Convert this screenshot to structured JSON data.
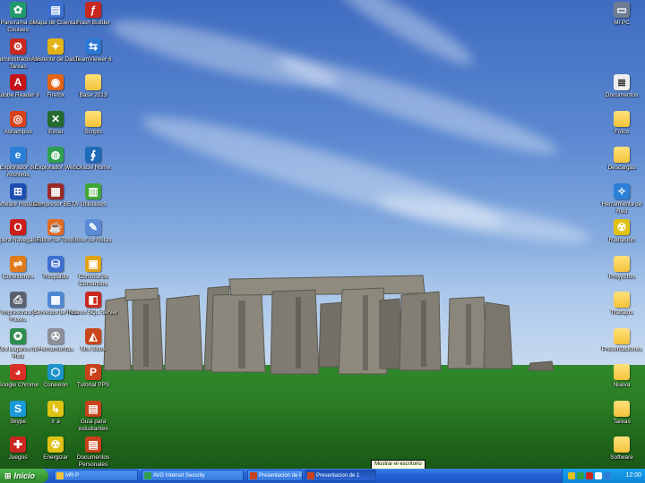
{
  "desktop": {
    "icons_left": [
      {
        "label": "Panorama de Coulees",
        "icon": "leaf-app-icon",
        "color": "#1f9a6b",
        "g": "✿"
      },
      {
        "label": "Mapa de Cuentas",
        "icon": "document-icon",
        "color": "#3b6fd0",
        "g": "▤"
      },
      {
        "label": "Flash Builder",
        "icon": "flash-icon",
        "color": "#c8281f",
        "g": "ƒ"
      },
      {
        "label": "Administrador de Tareas",
        "icon": "admin-tool-icon",
        "color": "#c8281f",
        "g": "⚙"
      },
      {
        "label": "Asistente de Datos",
        "icon": "bulb-icon",
        "color": "#e2b318",
        "g": "✦"
      },
      {
        "label": "TeamViewer 6",
        "icon": "teamviewer-icon",
        "color": "#2c78d4",
        "g": "⇆"
      },
      {
        "label": "Adobe Reader 9",
        "icon": "pdf-icon",
        "color": "#c3141a",
        "g": "A"
      },
      {
        "label": "Firefox",
        "icon": "firefox-icon",
        "color": "#e36414",
        "g": "◉"
      },
      {
        "label": "Base 2013",
        "icon": "folder-icon",
        "color": "#f3c33b",
        "g": ""
      },
      {
        "label": "Ashampoo",
        "icon": "ashampoo-icon",
        "color": "#d8421d",
        "g": "◎"
      },
      {
        "label": "Excel",
        "icon": "excel-icon",
        "color": "#256b2f",
        "g": "✕"
      },
      {
        "label": "Scripts",
        "icon": "folder-icon",
        "color": "#f3c33b",
        "g": ""
      },
      {
        "label": "Explorador de Archivos",
        "icon": "explorer-icon",
        "color": "#2b7fd7",
        "g": "e"
      },
      {
        "label": "Explorador Web",
        "icon": "globe-icon",
        "color": "#2e9f50",
        "g": "◍"
      },
      {
        "label": "Oracle Home",
        "icon": "oracle-icon",
        "color": "#1d6ab8",
        "g": "∮"
      },
      {
        "label": "Software Instalado",
        "icon": "windows-icon",
        "color": "#1d4fb3",
        "g": "⊞"
      },
      {
        "label": "Compresor BETA",
        "icon": "winrar-icon",
        "color": "#9d2a2a",
        "g": "▦"
      },
      {
        "label": "Utilidades",
        "icon": "utilities-icon",
        "color": "#3fa535",
        "g": "▥"
      },
      {
        "label": "Opera Navegador",
        "icon": "opera-icon",
        "color": "#cc1b1b",
        "g": "O"
      },
      {
        "label": "Editor de Texto",
        "icon": "java-icon",
        "color": "#e36a1f",
        "g": "☕"
      },
      {
        "label": "Bloc de Notas",
        "icon": "notepad-icon",
        "color": "#5c8bd6",
        "g": "✎"
      },
      {
        "label": "Conexiones",
        "icon": "network-icon",
        "color": "#e07a1a",
        "g": "⇌"
      },
      {
        "label": "Respaldo",
        "icon": "backup-icon",
        "color": "#3b6fd0",
        "g": "⛁"
      },
      {
        "label": "Consola de Comandos",
        "icon": "console-icon",
        "color": "#e0a215",
        "g": "▣"
      },
      {
        "label": "Impresoras y Faxes",
        "icon": "printer-icon",
        "color": "#58616f",
        "g": "⎙"
      },
      {
        "label": "Servicios de Red",
        "icon": "network-drive-icon",
        "color": "#4f88d6",
        "g": "▩"
      },
      {
        "label": "Nuevo SQL Server",
        "icon": "sql-icon",
        "color": "#c8281f",
        "g": "◧"
      },
      {
        "label": "Mis Lugares de Red",
        "icon": "network-places-icon",
        "color": "#2f8d4e",
        "g": "✪"
      },
      {
        "label": "Herramientas",
        "icon": "tools-icon",
        "color": "#8a8f99",
        "g": "✇"
      },
      {
        "label": "Mis Sitios",
        "icon": "office-icon",
        "color": "#c9461d",
        "g": "◭"
      },
      {
        "label": "Google Chrome",
        "icon": "chrome-icon",
        "color": "#d93025",
        "g": "◕"
      },
      {
        "label": "Conexion",
        "icon": "connection-icon",
        "color": "#1b92c9",
        "g": "⬡"
      },
      {
        "label": "Tutorial PPS",
        "icon": "powerpoint-icon",
        "color": "#c8421b",
        "g": "P"
      },
      {
        "label": "Skype",
        "icon": "skype-icon",
        "color": "#1b9ad9",
        "g": "S"
      },
      {
        "label": "Ir a",
        "icon": "shortcut-icon",
        "color": "#e0c215",
        "g": "↳"
      },
      {
        "label": "Guia para estudiantes",
        "icon": "guide-icon",
        "color": "#c8421b",
        "g": "▤"
      },
      {
        "label": "Juegos",
        "icon": "games-icon",
        "color": "#c8281f",
        "g": "✚"
      },
      {
        "label": "Energizar",
        "icon": "radiation-icon",
        "color": "#e0c215",
        "g": "☢"
      },
      {
        "label": "Documentos Personales",
        "icon": "docs-icon",
        "color": "#c8421b",
        "g": "▤"
      }
    ],
    "icons_right": [
      {
        "label": "Mi PC",
        "icon": "computer-icon",
        "color": "#6f7d92",
        "g": "▭",
        "folder": false
      },
      {
        "label": "Documentos",
        "icon": "text-file-icon",
        "color": "#eeeeee",
        "g": "≣",
        "folder": false
      },
      {
        "label": "Fotos",
        "icon": "folder-icon",
        "color": "#f3c33b",
        "g": "",
        "folder": true
      },
      {
        "label": "Descargas",
        "icon": "folder-icon",
        "color": "#f3c33b",
        "g": "",
        "folder": true
      },
      {
        "label": "Herramienta de Red",
        "icon": "safari-icon",
        "color": "#2b7fd7",
        "g": "✧",
        "folder": false
      },
      {
        "label": "Radiacion",
        "icon": "radiation-black-icon",
        "color": "#e0c215",
        "g": "☢",
        "folder": false
      },
      {
        "label": "Proyectos",
        "icon": "folder-icon",
        "color": "#f3c33b",
        "g": "",
        "folder": true
      },
      {
        "label": "Trabajos",
        "icon": "folder-icon",
        "color": "#f3c33b",
        "g": "",
        "folder": true
      },
      {
        "label": "Presentaciones",
        "icon": "folder-icon",
        "color": "#f3c33b",
        "g": "",
        "folder": true
      },
      {
        "label": "Nueva",
        "icon": "folder-icon",
        "color": "#f3c33b",
        "g": "",
        "folder": true
      },
      {
        "label": "Tareas",
        "icon": "folder-icon",
        "color": "#f3c33b",
        "g": "",
        "folder": true
      },
      {
        "label": "Software",
        "icon": "folder-icon",
        "color": "#f3c33b",
        "g": "",
        "folder": true
      }
    ],
    "tooltip": "Mostrar el escritorio"
  },
  "taskbar": {
    "start_label": "Inicio",
    "tasks": [
      {
        "label": "MR P",
        "color": "#f3c33b"
      },
      {
        "label": "AVG Internet Security",
        "color": "#2e9f50"
      },
      {
        "label": "Presentacion de PowerPoint",
        "color": "#c8421b"
      },
      {
        "label": "Presentacion de 1",
        "color": "#c8421b"
      }
    ],
    "active_task_index": 3,
    "clock": "12:00",
    "tray_colors": [
      "#e0c215",
      "#2e9f50",
      "#c8281f",
      "#ffffff",
      "#2b7fd7"
    ]
  }
}
